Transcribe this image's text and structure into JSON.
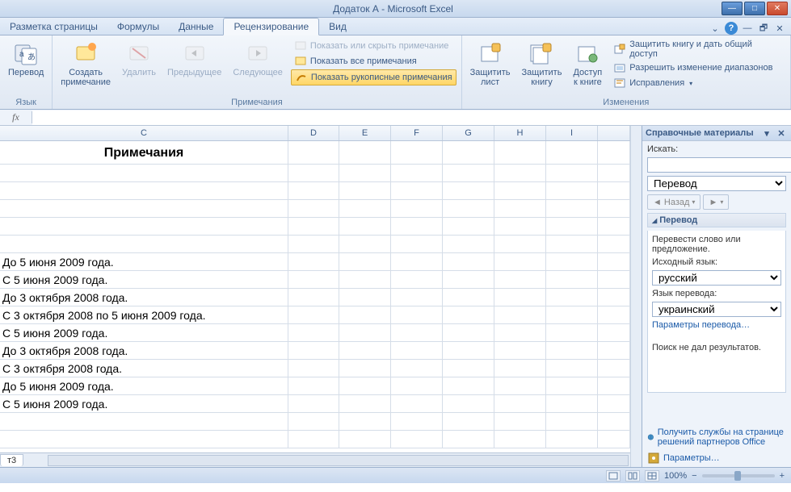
{
  "titlebar": {
    "title": "Додаток А  -  Microsoft Excel"
  },
  "tabs": {
    "items": [
      "Разметка страницы",
      "Формулы",
      "Данные",
      "Рецензирование",
      "Вид"
    ],
    "active_index": 3
  },
  "ribbon": {
    "group_lang": {
      "label": "Язык",
      "translate": "Перевод"
    },
    "group_comments": {
      "label": "Примечания",
      "new": "Создать\nпримечание",
      "delete": "Удалить",
      "prev": "Предыдущее",
      "next": "Следующее",
      "toggle": "Показать или скрыть примечание",
      "show_all": "Показать все примечания",
      "show_ink": "Показать рукописные примечания"
    },
    "group_changes": {
      "label": "Изменения",
      "protect_sheet": "Защитить\nлист",
      "protect_book": "Защитить\nкнигу",
      "share_book": "Доступ\nк книге",
      "protect_share": "Защитить книгу и дать общий доступ",
      "allow_ranges": "Разрешить изменение диапазонов",
      "track": "Исправления"
    }
  },
  "fx": {
    "label": "fx",
    "value": ""
  },
  "columns": [
    "C",
    "D",
    "E",
    "F",
    "G",
    "H",
    "I",
    ""
  ],
  "sheet_data": {
    "header": "Примечания",
    "rows": [
      "",
      "",
      "",
      "",
      "",
      "До 5 июня 2009 года.",
      "С 5 июня 2009 года.",
      "До 3 октября 2008 года.",
      "С 3 октября 2008 по 5 июня 2009 года.",
      "С 5 июня 2009 года.",
      "До 3 октября 2008 года.",
      "С 3 октября 2008 года.",
      "До 5 июня 2009 года.",
      "С 5 июня 2009 года.",
      "",
      ""
    ]
  },
  "taskpane": {
    "title": "Справочные материалы",
    "search_label": "Искать:",
    "search_value": "",
    "service": "Перевод",
    "back": "Назад",
    "section_hd": "Перевод",
    "instr": "Перевести слово или предложение.",
    "src_lang_label": "Исходный язык:",
    "src_lang": "русский",
    "tgt_lang_label": "Язык перевода:",
    "tgt_lang": "украинский",
    "params_link": "Параметры перевода…",
    "no_results": "Поиск не дал результатов.",
    "footer_services": "Получить службы на странице решений партнеров Office",
    "footer_options": "Параметры…"
  },
  "sheettab": "т3",
  "status": {
    "zoom": "100%",
    "minus": "−",
    "plus": "+"
  }
}
